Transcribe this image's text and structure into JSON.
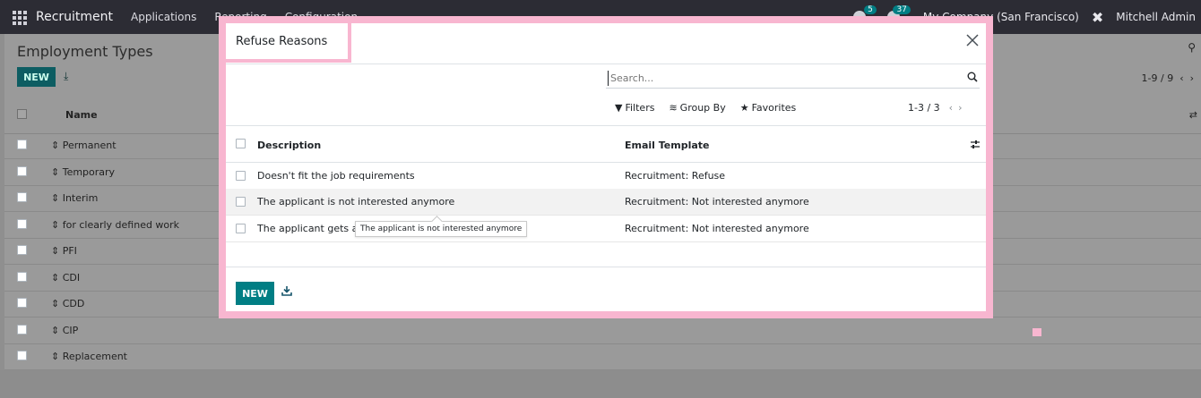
{
  "navbar": {
    "brand": "Recruitment",
    "menu": [
      "Applications",
      "Reporting",
      "Configuration"
    ],
    "badges": {
      "activity": "5",
      "messages": "37"
    },
    "company": "My Company (San Francisco)",
    "user": "Mitchell Admin"
  },
  "background": {
    "title": "Employment Types",
    "new_label": "NEW",
    "pager": "1-9 / 9",
    "column_name": "Name",
    "rows": [
      "Permanent",
      "Temporary",
      "Interim",
      "for clearly defined work",
      "PFI",
      "CDI",
      "CDD",
      "CIP",
      "Replacement"
    ]
  },
  "modal": {
    "title": "Refuse Reasons",
    "search_placeholder": "Search...",
    "filters_label": "Filters",
    "groupby_label": "Group By",
    "favorites_label": "Favorites",
    "pager": "1-3 / 3",
    "columns": {
      "description": "Description",
      "email_template": "Email Template"
    },
    "rows": [
      {
        "description": "Doesn't fit the job requirements",
        "template": "Recruitment: Refuse"
      },
      {
        "description": "The applicant is not interested anymore",
        "template": "Recruitment: Not interested anymore"
      },
      {
        "description": "The applicant gets a b",
        "template": "Recruitment: Not interested anymore"
      }
    ],
    "tooltip": "The applicant is not interested anymore",
    "new_label": "NEW"
  },
  "colors": {
    "accent": "#017e84",
    "highlight": "#f8b6d0",
    "navbar": "#2c2c34"
  }
}
